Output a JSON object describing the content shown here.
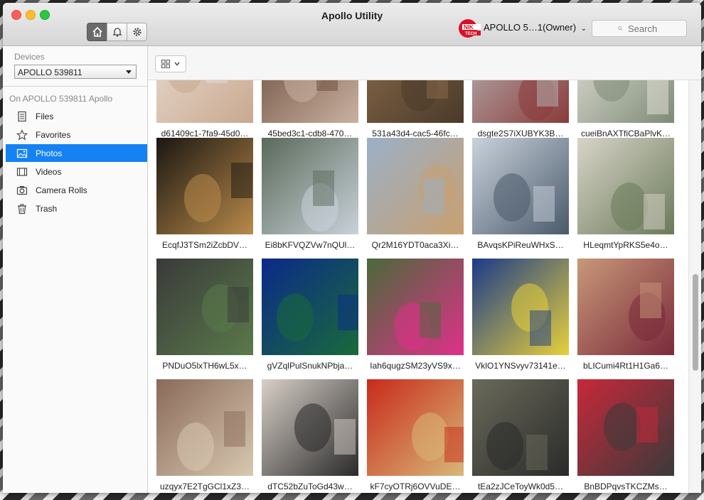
{
  "window": {
    "title": "Apollo Utility"
  },
  "titlebar": {
    "account_label": "APOLLO 5…1(Owner)",
    "search_placeholder": "Search",
    "logo_text": "NIKTECH"
  },
  "sidebar": {
    "devices_label": "Devices",
    "device_selected": "APOLLO 539811",
    "on_device_label": "On APOLLO 539811 Apollo",
    "items": [
      {
        "label": "Files",
        "icon": "file-icon"
      },
      {
        "label": "Favorites",
        "icon": "star-icon"
      },
      {
        "label": "Photos",
        "icon": "photo-icon",
        "selected": true
      },
      {
        "label": "Videos",
        "icon": "video-icon"
      },
      {
        "label": "Camera Rolls",
        "icon": "camera-icon"
      },
      {
        "label": "Trash",
        "icon": "trash-icon"
      }
    ]
  },
  "colors": {
    "accent": "#1582f3"
  },
  "photos": [
    {
      "name": "d61409c1-7fa9-45d0…",
      "c1": "#e9dcd2",
      "c2": "#c9a98f"
    },
    {
      "name": "45bed3c1-cdb8-470…",
      "c1": "#6b4a3c",
      "c2": "#c9b1a0"
    },
    {
      "name": "531a43d4-cac5-46fc…",
      "c1": "#8b6b4a",
      "c2": "#4a3a2a"
    },
    {
      "name": "dsgte2S7iXUBYK3B…",
      "c1": "#b8b8b8",
      "c2": "#8a3a3a"
    },
    {
      "name": "cueiBnAXTfiCBaPlvK…",
      "c1": "#e8e4dc",
      "c2": "#7d8b76"
    },
    {
      "name": "EcqfJ3TSm2iZcbDV…",
      "c1": "#1b1712",
      "c2": "#b98a4a"
    },
    {
      "name": "Ei8bKFVQZVw7nQUl…",
      "c1": "#5a6a5a",
      "c2": "#c9d2da"
    },
    {
      "name": "Qr2M16YDT0aca3Xi…",
      "c1": "#9ab0c8",
      "c2": "#c9a070"
    },
    {
      "name": "BAvqsKPiReuWHxS…",
      "c1": "#c9d2dc",
      "c2": "#4a5a6a"
    },
    {
      "name": "HLeqmtYpRKS5e4o…",
      "c1": "#d8d4c8",
      "c2": "#6a7a5a"
    },
    {
      "name": "PNDuO5lxTH6wL5x…",
      "c1": "#3a3a3a",
      "c2": "#5a7a4a"
    },
    {
      "name": "gVZqlPulSnukNPbja…",
      "c1": "#0a2a8a",
      "c2": "#1a6a3a"
    },
    {
      "name": "Iah6qugzSM23yVS9x…",
      "c1": "#4a6a3a",
      "c2": "#e0308a"
    },
    {
      "name": "VklO1YNSvyv73141e…",
      "c1": "#1a3a8a",
      "c2": "#e8d03a"
    },
    {
      "name": "bLICumi4Rt1H1Ga6…",
      "c1": "#c89878",
      "c2": "#7a2a3a"
    },
    {
      "name": "uzqyx7E2TgGCl1xZ3…",
      "c1": "#8a6a5a",
      "c2": "#d8c8b0"
    },
    {
      "name": "dTC52bZuToGd43w…",
      "c1": "#d8d0c8",
      "c2": "#2a2a2a"
    },
    {
      "name": "kF7cyOTRj6OVVuDE…",
      "c1": "#c82a1a",
      "c2": "#d8b878"
    },
    {
      "name": "tEa2zJCeToyWk0d5…",
      "c1": "#6a6a5a",
      "c2": "#2a2a2a"
    },
    {
      "name": "BnBDPqvsTKCZMs…",
      "c1": "#c8283a",
      "c2": "#3a3a3a"
    }
  ]
}
